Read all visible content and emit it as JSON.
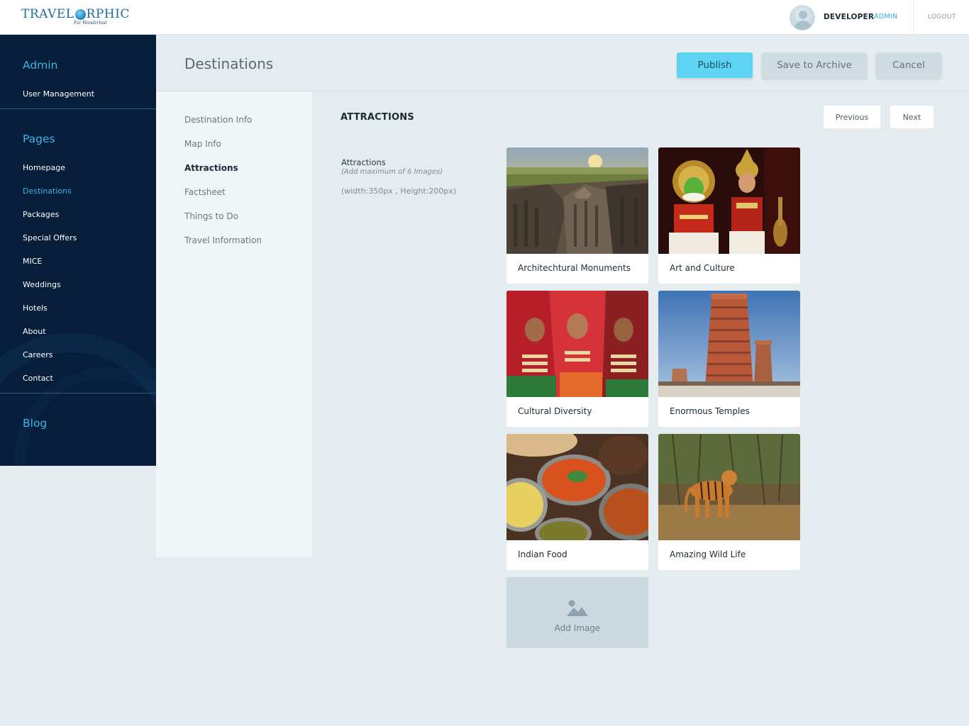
{
  "brand": {
    "name_left": "TRAVEL",
    "name_right": "RPHIC",
    "tagline": "For Wanderlust"
  },
  "user": {
    "name": "DEVELOPER",
    "role": "ADMIN",
    "logout": "LOGOUT"
  },
  "sidebar": {
    "admin_heading": "Admin",
    "admin_items": [
      "User Management"
    ],
    "pages_heading": "Pages",
    "pages_items": [
      "Homepage",
      "Destinations",
      "Packages",
      "Special Offers",
      "MICE",
      "Weddings",
      "Hotels",
      "About",
      "Careers",
      "Contact"
    ],
    "active_item": "Destinations",
    "blog_heading": "Blog"
  },
  "header": {
    "title": "Destinations",
    "publish_label": "Publish",
    "archive_label": "Save to Archive",
    "cancel_label": "Cancel"
  },
  "subnav": {
    "items": [
      "Destination Info",
      "Map Info",
      "Attractions",
      "Factsheet",
      "Things to Do",
      "Travel Information"
    ],
    "active": "Attractions"
  },
  "content": {
    "section_title": "ATTRACTIONS",
    "previous_label": "Previous",
    "next_label": "Next",
    "field_label": "Attractions",
    "field_hint": "(Add maximum of 6 Images)",
    "field_dims": "(width:350px , Height:200px)",
    "cards": [
      {
        "label": "Architechtural Monuments",
        "image": "rock-monument-photo"
      },
      {
        "label": "Art and Culture",
        "image": "kathakali-dancers-photo"
      },
      {
        "label": "Cultural Diversity",
        "image": "rajasthani-women-photo"
      },
      {
        "label": "Enormous Temples",
        "image": "gopuram-temple-photo"
      },
      {
        "label": "Indian Food",
        "image": "curry-dishes-photo"
      },
      {
        "label": "Amazing Wild Life",
        "image": "tiger-forest-photo"
      }
    ],
    "add_image_label": "Add Image"
  },
  "colors": {
    "sidebar_bg": "#061e3a",
    "accent": "#3bb4e8",
    "publish_bg": "#5ed3f4",
    "secondary_btn_bg": "#cfdde3",
    "page_bg": "#e5ecef"
  }
}
